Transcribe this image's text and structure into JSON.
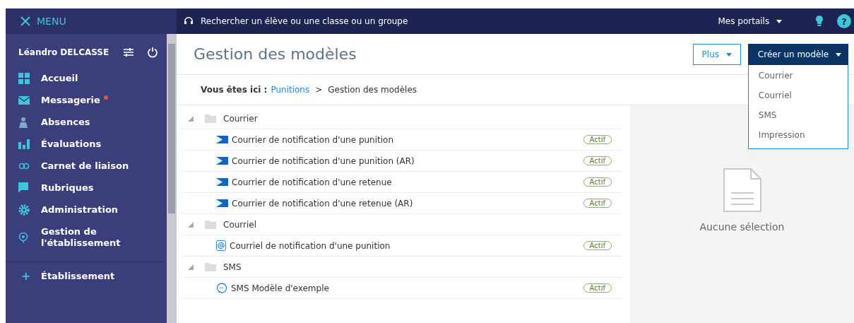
{
  "menu": {
    "label": "MENU"
  },
  "search": {
    "placeholder": "Rechercher un élève ou une classe ou un groupe"
  },
  "portals": {
    "label": "Mes portails"
  },
  "help": {
    "label": "?"
  },
  "user": {
    "name": "Léandro DELCASSE"
  },
  "sidebar": {
    "items": [
      {
        "label": "Accueil",
        "notification": false
      },
      {
        "label": "Messagerie",
        "notification": true
      },
      {
        "label": "Absences",
        "notification": false
      },
      {
        "label": "Évaluations",
        "notification": false
      },
      {
        "label": "Carnet de liaison",
        "notification": false
      },
      {
        "label": "Rubriques",
        "notification": false
      },
      {
        "label": "Administration",
        "notification": false
      },
      {
        "label": "Gestion de l'établissement",
        "notification": false
      }
    ],
    "sections": [
      {
        "label": "Établissement",
        "icon": "+"
      }
    ]
  },
  "page": {
    "title": "Gestion des modèles",
    "more_button": "Plus",
    "create_button": "Créer un modèle"
  },
  "create_menu": {
    "expanded": true,
    "items": [
      "Courrier",
      "Courriel",
      "SMS",
      "Impression"
    ]
  },
  "breadcrumb": {
    "prefix": "Vous êtes ici :",
    "link": "Punitions",
    "separator": ">",
    "current": "Gestion des modèles"
  },
  "tree": [
    {
      "label": "Courrier",
      "expanded": true,
      "children": [
        {
          "label": "Courrier de notification d'une punition",
          "kind": "letter",
          "status": "Actif"
        },
        {
          "label": "Courrier de notification d'une punition (AR)",
          "kind": "letter",
          "status": "Actif"
        },
        {
          "label": "Courrier de notification d'une retenue",
          "kind": "letter",
          "status": "Actif"
        },
        {
          "label": "Courrier de notification d'une retenue (AR)",
          "kind": "letter",
          "status": "Actif"
        }
      ]
    },
    {
      "label": "Courriel",
      "expanded": true,
      "children": [
        {
          "label": "Courriel de notification d'une punition",
          "kind": "email",
          "status": "Actif"
        }
      ]
    },
    {
      "label": "SMS",
      "expanded": true,
      "children": [
        {
          "label": "SMS Modèle d'exemple",
          "kind": "sms",
          "status": "Actif"
        }
      ]
    }
  ],
  "detail": {
    "empty_text": "Aucune sélection"
  }
}
